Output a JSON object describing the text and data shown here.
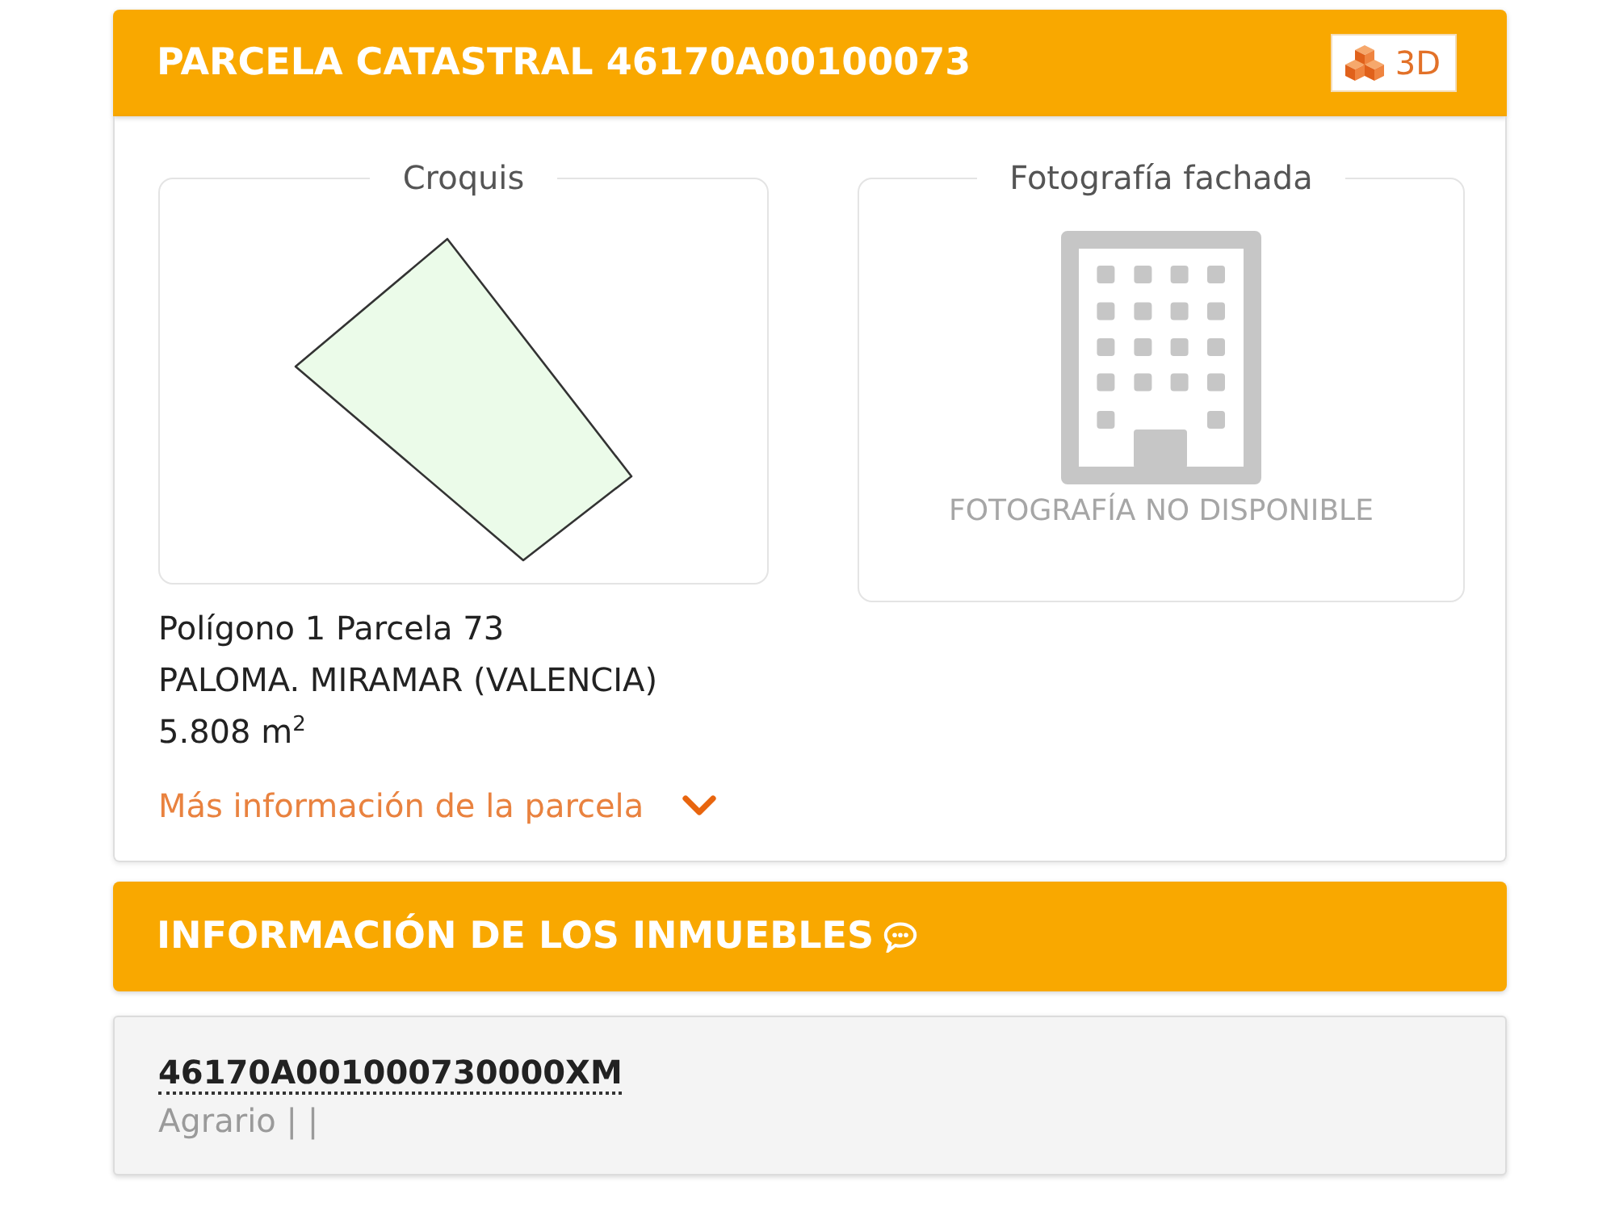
{
  "parcel": {
    "title": "PARCELA CATASTRAL 46170A00100073",
    "view_3d_button": "3D",
    "sketch": {
      "legend": "Croquis"
    },
    "facade_photo": {
      "legend": "Fotografía fachada",
      "unavailable_text": "FOTOGRAFÍA NO DISPONIBLE"
    },
    "location": "Polígono 1 Parcela 73",
    "municipality": "PALOMA. MIRAMAR (VALENCIA)",
    "area": "5.808 m$^{2}$",
    "more_info": {
      "label": "Más información de la parcela",
      "expanded": false
    }
  },
  "properties": {
    "title": "INFORMACIÓN DE LOS INMUEBLES",
    "items": [
      {
        "reference": "46170A001000730000XM",
        "summary": "Agrario | |"
      }
    ]
  }
}
